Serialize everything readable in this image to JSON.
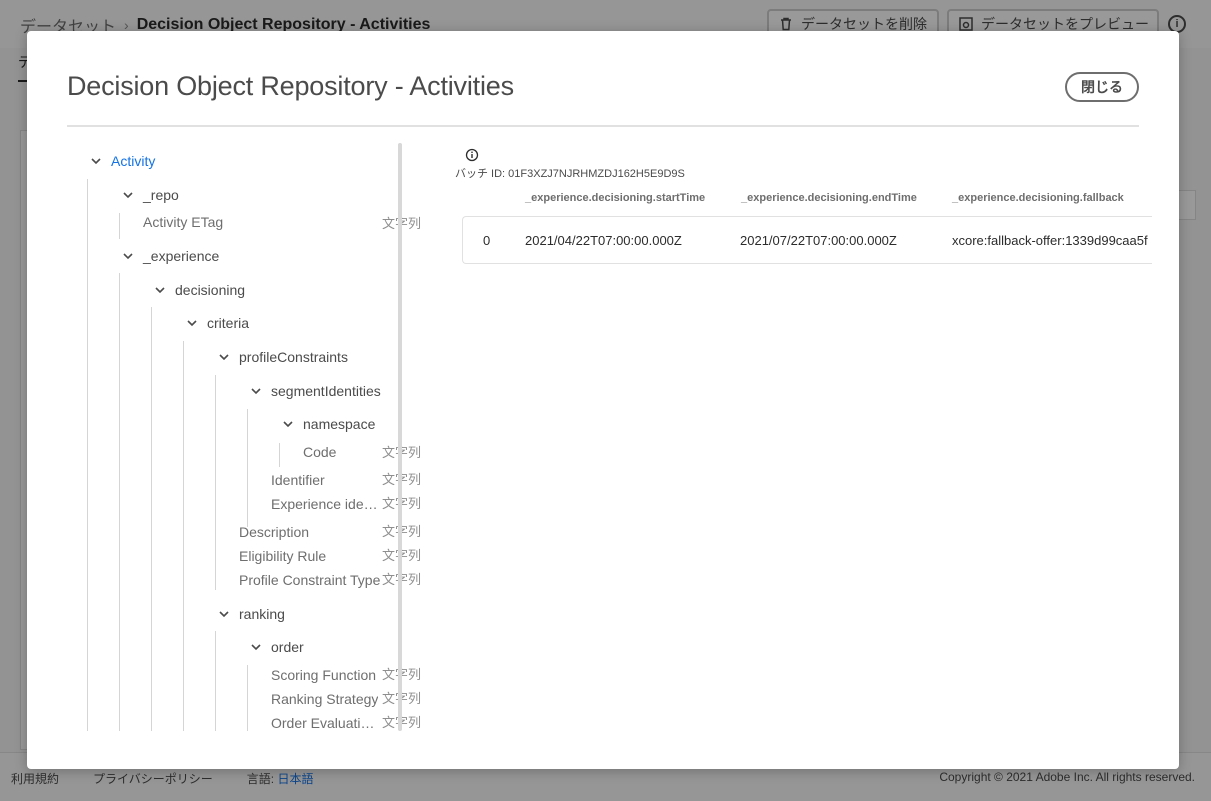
{
  "background": {
    "breadcrumb": {
      "root": "データセット",
      "separator": "›",
      "current": "Decision Object Repository - Activities"
    },
    "delete_button": "データセットを削除",
    "preview_button": "データセットをプレビュー",
    "info_icon": "i",
    "tab_label": "デ",
    "footer": {
      "terms": "利用規約",
      "privacy": "プライバシーポリシー",
      "language_label": "言語:",
      "language_value": "日本語",
      "copyright": "Copyright © 2021 Adobe Inc. All rights reserved."
    }
  },
  "dialog": {
    "title": "Decision Object Repository - Activities",
    "close_label": "閉じる",
    "tree": {
      "root": "Activity",
      "repo": "_repo",
      "activity_etag": "Activity ETag",
      "experience": "_experience",
      "decisioning": "decisioning",
      "criteria": "criteria",
      "profile_constraints": "profileConstraints",
      "segment_identities": "segmentIdentities",
      "namespace": "namespace",
      "code": "Code",
      "identifier": "Identifier",
      "experience_identifier": "Experience identi…",
      "description": "Description",
      "eligibility_rule": "Eligibility Rule",
      "profile_constraint_type": "Profile Constraint Type",
      "ranking": "ranking",
      "order": "order",
      "scoring_function": "Scoring Function",
      "ranking_strategy": "Ranking Strategy",
      "order_evaluation": "Order Evaluation …",
      "type_string": "文字列"
    },
    "preview": {
      "batch_id": "バッチ ID: 01F3XZJ7NJRHMZDJ162H5E9D9S",
      "columns": [
        "_experience.decisioning.startTime",
        "_experience.decisioning.endTime",
        "_experience.decisioning.fallback"
      ],
      "rows": [
        {
          "index": "0",
          "start": "2021/04/22T07:00:00.000Z",
          "end": "2021/07/22T07:00:00.000Z",
          "fallback": "xcore:fallback-offer:1339d99caa5f"
        }
      ]
    }
  }
}
